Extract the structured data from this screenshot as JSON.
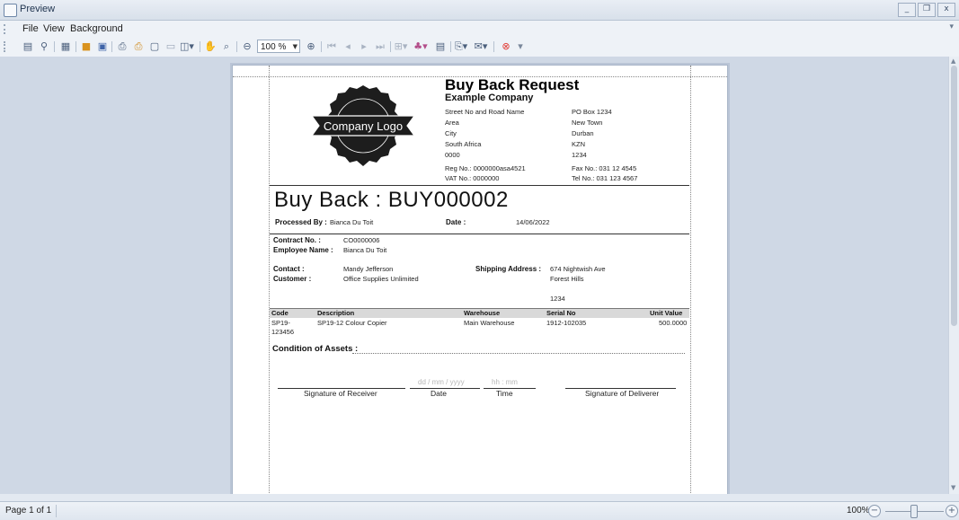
{
  "window": {
    "title": "Preview",
    "buttons": [
      "_",
      "❒",
      "x"
    ]
  },
  "menu": {
    "items": [
      "File",
      "View",
      "Background"
    ]
  },
  "toolbar": {
    "zoom_value": "100 %"
  },
  "report": {
    "title": "Buy Back Request",
    "company": "Example Company",
    "logo_text": "Company Logo",
    "address_lines": [
      "Street No and Road Name",
      "Area",
      "City",
      "South Africa",
      "0000"
    ],
    "postal_lines": [
      "PO Box 1234",
      "New Town",
      "Durban",
      "KZN",
      "1234"
    ],
    "reg_no": "Reg No.: 0000000asa4521",
    "vat_no": "VAT No.: 0000000",
    "fax_no": "Fax No.: 031 12 4545",
    "tel_no": "Tel No.: 031 123 4567",
    "heading": "Buy Back : BUY000002",
    "processed_by_label": "Processed By :",
    "processed_by": "Bianca Du Toit",
    "date_label": "Date :",
    "date": "14/06/2022",
    "contract_label": "Contract No. :",
    "contract_no": "CO0000006",
    "employee_label": "Employee Name :",
    "employee_name": "Bianca Du Toit",
    "contact_label": "Contact :",
    "contact": "Mandy Jefferson",
    "customer_label": "Customer :",
    "customer": "Office Supplies Unlimited",
    "shipping_label": "Shipping Address :",
    "shipping_lines": [
      "674 Nightwish Ave",
      "Forest Hills",
      "",
      "1234"
    ],
    "table": {
      "headers": [
        "Code",
        "Description",
        "Warehouse",
        "Serial No",
        "Unit Value"
      ],
      "rows": [
        {
          "code_line1": "SP19-",
          "code_line2": "123456",
          "description": "SP19-12 Colour Copier",
          "warehouse": "Main Warehouse",
          "serial": "1912-102035",
          "unit_value": "500.0000"
        }
      ]
    },
    "condition_label": "Condition of Assets :",
    "date_placeholder": "dd / mm / yyyy",
    "time_placeholder": "hh : mm",
    "sig_receiver": "Signature of Receiver",
    "sig_date": "Date",
    "sig_time": "Time",
    "sig_deliverer": "Signature of Deliverer"
  },
  "status": {
    "page_info": "Page 1 of 1",
    "zoom": "100%",
    "zoom_level": 0.5
  }
}
